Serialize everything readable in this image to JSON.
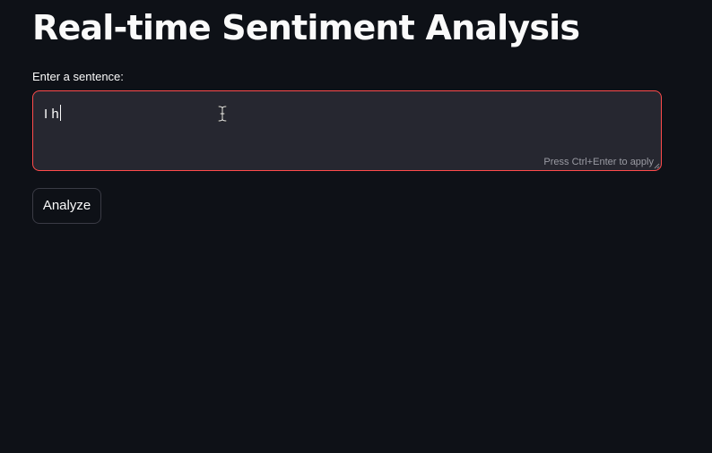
{
  "header": {
    "title": "Real-time Sentiment Analysis"
  },
  "form": {
    "label": "Enter a sentence:",
    "value": "I h",
    "hint": "Press Ctrl+Enter to apply",
    "button_label": "Analyze"
  },
  "theme": {
    "background": "#0e1117",
    "input_background": "#262730",
    "focus_border": "#ff4b4b",
    "text": "#fafafa"
  },
  "icons": {
    "pointer": "text-cursor-icon",
    "resize": "resize-handle-icon"
  }
}
